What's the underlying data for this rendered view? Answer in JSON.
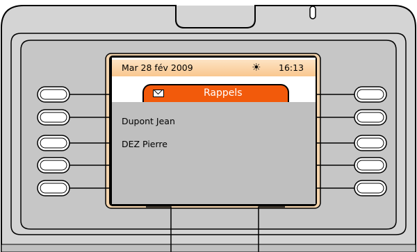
{
  "status": {
    "date": "Mar 28 fév 2009",
    "time": "16:13",
    "weather_icon": "sun-icon"
  },
  "tab": {
    "title": "Rappels",
    "icon": "envelope-icon"
  },
  "list": {
    "items": [
      "Dupont Jean",
      "DEZ Pierre"
    ]
  },
  "colors": {
    "accent": "#f25a0b",
    "status_bg": "#f9c78f",
    "content_bg": "#bfbfbf",
    "frame": "#d9d9d9"
  }
}
